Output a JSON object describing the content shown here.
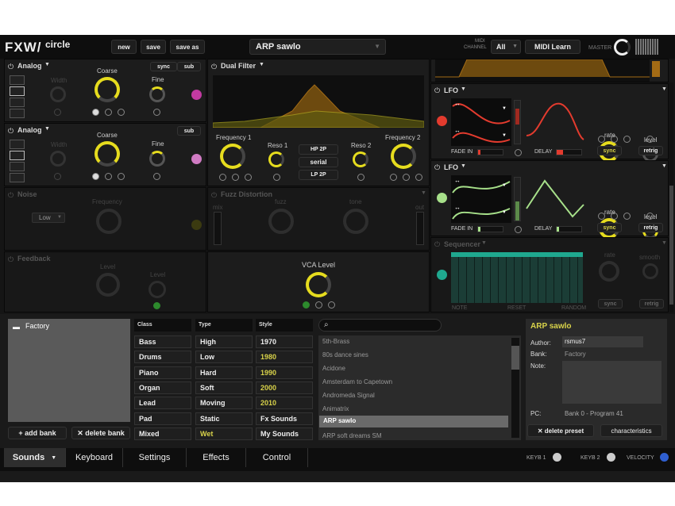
{
  "header": {
    "logo": "FXW/",
    "app_name": "circle",
    "new_label": "new",
    "save_label": "save",
    "save_as_label": "save as",
    "preset_name": "ARP sawlo",
    "midi_label": "MIDI",
    "channel_label": "CHANNEL",
    "channel_value": "All",
    "midi_learn_label": "MIDI Learn",
    "master_label": "MASTER"
  },
  "osc1": {
    "title": "Analog",
    "sync": "sync",
    "sub": "sub",
    "width": "Width",
    "coarse": "Coarse",
    "fine": "Fine"
  },
  "osc2": {
    "title": "Analog",
    "sub": "sub",
    "width": "Width",
    "coarse": "Coarse",
    "fine": "Fine"
  },
  "noise": {
    "title": "Noise",
    "select": "Low",
    "frequency": "Frequency"
  },
  "feedback": {
    "title": "Feedback",
    "level_a": "Level",
    "level_b": "Level"
  },
  "filter": {
    "title": "Dual Filter",
    "freq1": "Frequency 1",
    "reso1": "Reso 1",
    "hp": "HP 2P",
    "serial": "serial",
    "lp": "LP 2P",
    "reso2": "Reso 2",
    "freq2": "Frequency 2"
  },
  "fuzz": {
    "title": "Fuzz Distortion",
    "fuzz": "fuzz",
    "tone": "tone",
    "mix": "mix",
    "out": "out"
  },
  "vca": {
    "title": "VCA Level"
  },
  "lfo1": {
    "title": "LFO",
    "fade_in": "FADE IN",
    "delay": "DELAY",
    "rate": "rate",
    "level": "level",
    "sync": "sync",
    "retrig": "retrig",
    "color": "#e33b2e"
  },
  "lfo2": {
    "title": "LFO",
    "fade_in": "FADE IN",
    "delay": "DELAY",
    "rate": "rate",
    "level": "level",
    "sync": "sync",
    "retrig": "retrig",
    "color": "#a7e08a"
  },
  "seq": {
    "title": "Sequencer",
    "rate": "rate",
    "smooth": "smooth",
    "note": "NOTE",
    "reset": "RESET",
    "random": "RANDOM",
    "sync": "sync",
    "retrig": "retrig",
    "color": "#1fa88f"
  },
  "browser": {
    "bank": "Factory",
    "add_bank": "add bank",
    "delete_bank": "delete bank",
    "class_header": "Class",
    "type_header": "Type",
    "style_header": "Style",
    "class_items": [
      "Bass",
      "Drums",
      "Piano",
      "Organ",
      "Lead",
      "Pad",
      "Mixed"
    ],
    "type_items": [
      "High",
      "Low",
      "Hard",
      "Soft",
      "Moving",
      "Static",
      "Wet"
    ],
    "style_items": [
      "1970",
      "1980",
      "1990",
      "2000",
      "2010",
      "Fx Sounds",
      "My Sounds"
    ],
    "presets": [
      "5th-Brass",
      "80s dance sines",
      "Acidone",
      "Amsterdam to Capetown",
      "Andromeda Signal",
      "Animatrix",
      "ARP sawlo",
      "ARP soft dreams SM"
    ],
    "selected_preset": "ARP sawlo"
  },
  "info": {
    "title": "ARP sawlo",
    "author_label": "Author:",
    "author_value": "rsmus7",
    "bank_label": "Bank:",
    "bank_value": "Factory",
    "note_label": "Note:",
    "pc_label": "PC:",
    "pc_value": "Bank 0 - Program 41",
    "delete_preset": "delete preset",
    "characteristics": "characteristics"
  },
  "tabs": [
    "Sounds",
    "Keyboard",
    "Settings",
    "Effects",
    "Control"
  ],
  "footer": {
    "keyb1": "KEYB 1",
    "keyb2": "KEYB 2",
    "velocity": "VELOCITY"
  },
  "colors": {
    "accent": "#e6dc1e",
    "highlight": "#d9d34a",
    "osc_led": "#c23aa1",
    "osc2_led": "#d07bc3"
  }
}
